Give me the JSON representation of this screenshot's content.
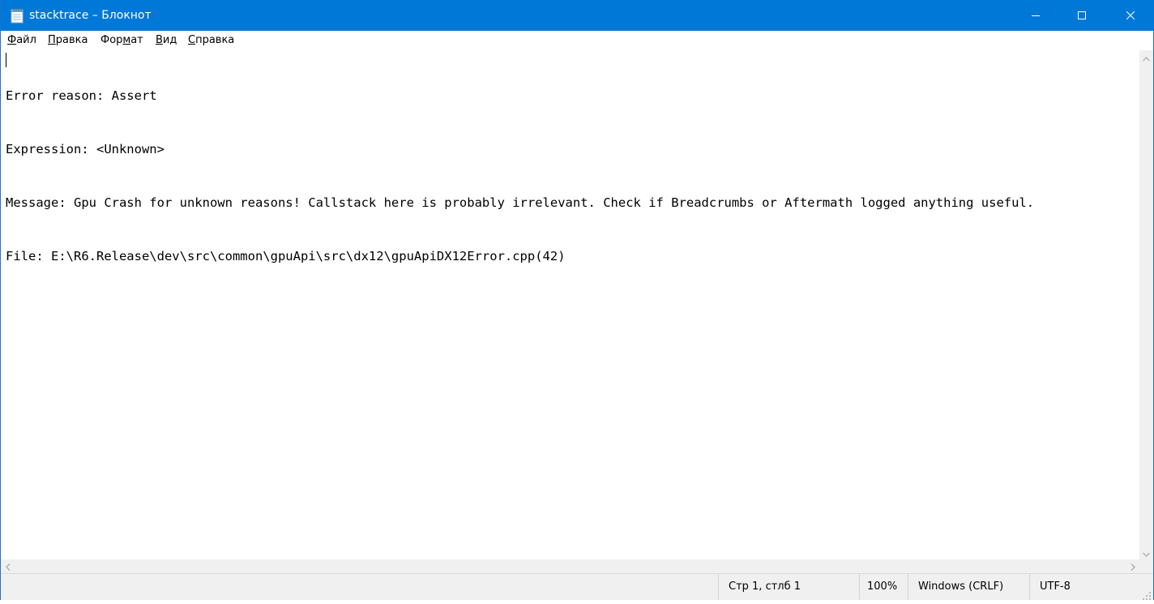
{
  "window": {
    "title": "stacktrace – Блокнот",
    "accent_color": "#0078d7",
    "app_icon": "notepad-icon",
    "controls": {
      "minimize_icon": "minimize-icon",
      "maximize_icon": "maximize-icon",
      "close_icon": "close-icon"
    }
  },
  "menu": {
    "items": [
      {
        "first": "Ф",
        "rest": "айл",
        "underlined": "Ф"
      },
      {
        "first": "П",
        "rest": "равка",
        "underlined": "П"
      },
      {
        "pre": "Фор",
        "u": "м",
        "post": "ат"
      },
      {
        "first": "В",
        "rest": "ид",
        "underlined": "В"
      },
      {
        "first": "С",
        "rest": "правка",
        "underlined": "С"
      }
    ]
  },
  "editor": {
    "lines": [
      "Error reason: Assert",
      "Expression: <Unknown>",
      "Message: Gpu Crash for unknown reasons! Callstack here is probably irrelevant. Check if Breadcrumbs or Aftermath logged anything useful.",
      "File: E:\\R6.Release\\dev\\src\\common\\gpuApi\\src\\dx12\\gpuApiDX12Error.cpp(42)"
    ]
  },
  "statusbar": {
    "position": "Стр 1, стлб 1",
    "zoom": "100%",
    "line_ending": "Windows (CRLF)",
    "encoding": "UTF-8"
  }
}
